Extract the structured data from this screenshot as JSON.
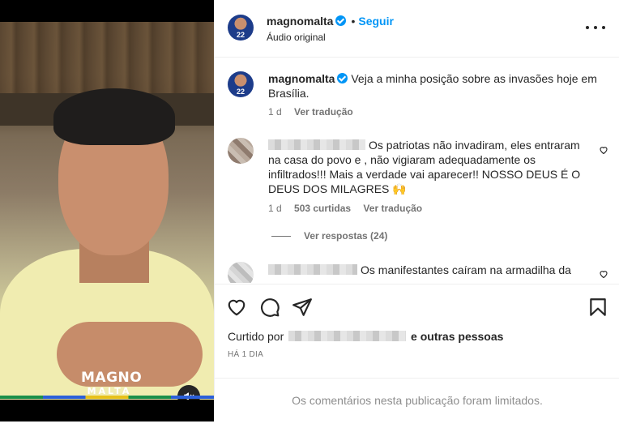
{
  "video": {
    "overlay_logo_line1": "MAGNO",
    "overlay_logo_line2": "MALTA",
    "mute_icon": "speaker-muted-icon"
  },
  "header": {
    "username": "magnomalta",
    "verified_icon": "verified-badge-icon",
    "separator": "•",
    "follow_label": "Seguir",
    "audio_label": "Áudio original",
    "more_icon": "more-options-icon",
    "avatar_number": "22"
  },
  "caption": {
    "username": "magnomalta",
    "text": "Veja a minha posição sobre as invasões hoje em Brasília.",
    "age": "1 d",
    "translate_label": "Ver tradução"
  },
  "comments": [
    {
      "text": "Os patriotas não invadiram, eles entraram na casa do povo e , não vigiaram adequadamente os infiltrados!!! Mais a verdade vai aparecer!! NOSSO DEUS É O DEUS DOS MILAGRES 🙌",
      "age": "1 d",
      "likes": "503 curtidas",
      "translate_label": "Ver tradução",
      "replies_label": "Ver respostas (24)"
    },
    {
      "text": "Os manifestantes caíram na armadilha da"
    }
  ],
  "actions": {
    "like_icon": "heart-icon",
    "comment_icon": "comment-icon",
    "share_icon": "share-icon",
    "save_icon": "bookmark-icon"
  },
  "likes_summary": {
    "prefix": "Curtido por",
    "suffix": "e outras pessoas"
  },
  "time_ago": "HÁ 1 DIA",
  "comments_limited": "Os comentários nesta publicação foram limitados."
}
